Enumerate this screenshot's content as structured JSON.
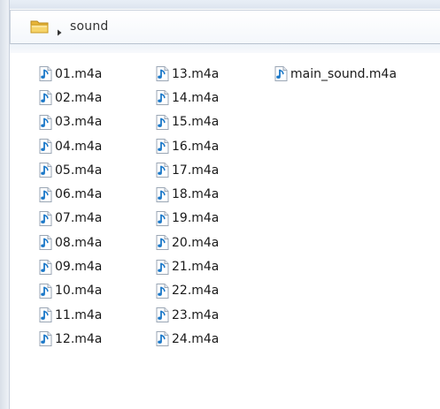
{
  "address_bar": {
    "folder_icon": "folder-icon",
    "separator_icon": "chevron-right-icon",
    "path_segment": "sound"
  },
  "file_icon": "audio-file-music-note-icon",
  "files": {
    "column_1": [
      "01.m4a",
      "02.m4a",
      "03.m4a",
      "04.m4a",
      "05.m4a",
      "06.m4a",
      "07.m4a",
      "08.m4a",
      "09.m4a",
      "10.m4a",
      "11.m4a",
      "12.m4a"
    ],
    "column_2": [
      "13.m4a",
      "14.m4a",
      "15.m4a",
      "16.m4a",
      "17.m4a",
      "18.m4a",
      "19.m4a",
      "20.m4a",
      "21.m4a",
      "22.m4a",
      "23.m4a",
      "24.m4a"
    ],
    "column_3": [
      "main_sound.m4a"
    ]
  },
  "colors": {
    "note_blue": "#1b78c8",
    "folder_yellow": "#f3c64c",
    "border": "#b8c2cf"
  }
}
